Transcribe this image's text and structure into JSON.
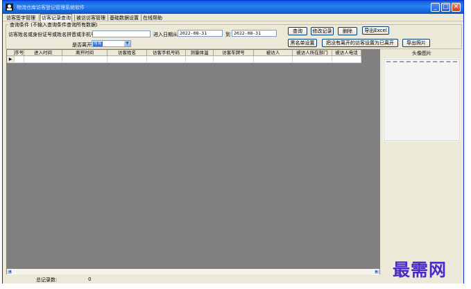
{
  "window": {
    "title": "物流仓库访客登记管理系统软件",
    "buttons": {
      "minimize": "_",
      "maximize": "□",
      "close": "✕"
    }
  },
  "menu": [
    {
      "label": "访客签字管理"
    },
    {
      "label": "访客记录查询"
    },
    {
      "label": "被访访客管理"
    },
    {
      "label": "基础数据设置"
    },
    {
      "label": "在线帮助"
    }
  ],
  "search": {
    "group_label": "查询条件 (不输入查询条件查询所有数据)",
    "keyword_label": "访客姓名或身份证号或姓名拼音或手机号",
    "keyword_value": "",
    "date_from_label": "进入日期从",
    "date_from": "2022-08-31",
    "date_to_label": "到",
    "date_to": "2022-08-31",
    "left_label": "是否离开",
    "left_value": "所有"
  },
  "buttons": {
    "query": "查询",
    "modify": "修改记录",
    "delete": "删除",
    "export_excel": "导出Excel",
    "blacklist": "黑名单设置",
    "mark_left": "把没有离开的访客设置为已离开",
    "export_photo": "导出照片"
  },
  "table": {
    "columns": [
      "序号",
      "进入时间",
      "离开时间",
      "访客姓名",
      "访客手机号码",
      "测量体温",
      "访客车牌号",
      "被访人",
      "被访人所在部门",
      "被访人电话"
    ],
    "rows": []
  },
  "photo": {
    "title": "头像图片"
  },
  "status": {
    "total_label": "总记录数:",
    "total_value": "0"
  },
  "watermark": "最需网"
}
